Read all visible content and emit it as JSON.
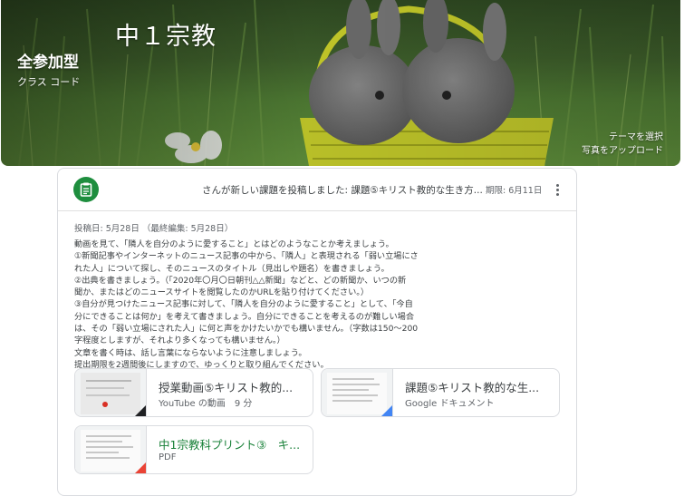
{
  "course": {
    "title": "中１宗教",
    "section": "全参加型",
    "class_code_label": "クラス コード",
    "select_theme": "テーマを選択",
    "upload_photo": "写真をアップロード"
  },
  "post": {
    "header_text": "さんが新しい課題を投稿しました: 課題⑤キリスト教的な生き方...",
    "due": "期限: 6月11日",
    "posted": "投稿日: 5月28日 （最終編集: 5月28日）",
    "body": "動画を見て、「隣人を自分のように愛すること」とはどのようなことか考えましょう。\n①新聞記事やインターネットのニュース記事の中から、「隣人」と表現される「弱い立場にさ\nれた人」について探し、そのニュースのタイトル（見出しや題名）を書きましょう。\n②出典を書きましょう。（「2020年〇月〇日朝刊△△新聞」などと、どの新聞か、いつの新\n聞か、またはどのニュースサイトを閲覧したのかURLを貼り付けてください。）\n③自分が見つけたニュース記事に対して、「隣人を自分のように愛すること」として、「今自\n分にできることは何か」を考えて書きましょう。自分にできることを考えるのが難しい場合\nは、その「弱い立場にされた人」に何と声をかけたいかでも構いません。（字数は150〜200\n字程度としますが、それより多くなっても構いません。）\n文章を書く時は、話し言葉にならないように注意しましょう。\n提出期限を2週間後にしますので、ゆっくりと取り組んでください。",
    "attachments": [
      {
        "title": "授業動画⑤キリスト教的...",
        "subtitle": "YouTube の動画　9 分",
        "type": "youtube"
      },
      {
        "title": "課題⑤キリスト教的な生...",
        "subtitle": "Google ドキュメント",
        "type": "doc"
      },
      {
        "title": "中1宗教科プリント③　キ...",
        "subtitle": "PDF",
        "type": "pdf"
      }
    ]
  },
  "colors": {
    "assignment_icon": "#1e8e3e",
    "doc_corner": "#4285f4",
    "pdf_corner": "#ea4335",
    "video_corner": "#202124",
    "pdf_title": "#188038"
  },
  "icons": [
    "assignment-icon",
    "more-vert-icon"
  ]
}
